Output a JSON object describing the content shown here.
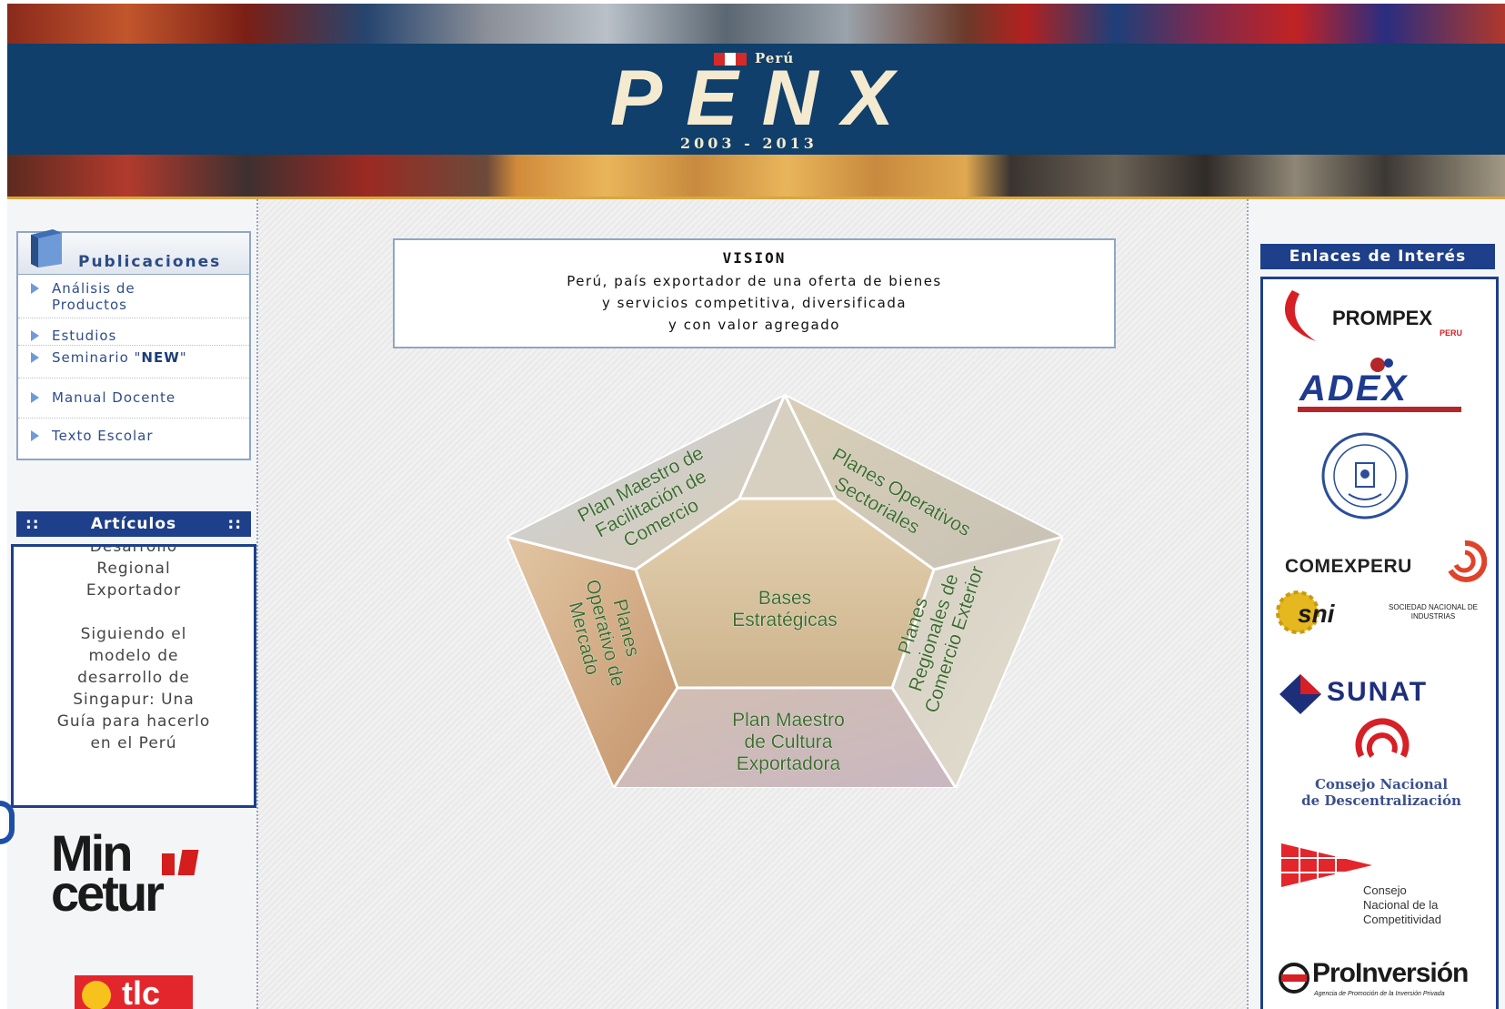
{
  "header": {
    "country": "Perú",
    "logo": "PENX",
    "years": "2003 - 2013"
  },
  "publicaciones": {
    "title": "Publicaciones",
    "items": [
      {
        "label_line1": "Análisis de",
        "label_line2": "Productos"
      },
      {
        "label": "Estudios"
      },
      {
        "label": "Seminario \"",
        "badge": "NEW",
        "suffix": "\""
      },
      {
        "label": "Manual Docente"
      },
      {
        "label": "Texto Escolar"
      }
    ]
  },
  "articulos": {
    "title": "Artículos",
    "marker": "::",
    "item1": [
      "Desarrollo",
      "Regional",
      "Exportador"
    ],
    "item2": [
      "Siguiendo el",
      "modelo de",
      "desarrollo de",
      "Singapur: Una",
      "Guía para hacerlo",
      "en el Perú"
    ]
  },
  "sponsors": {
    "mincetur_line1": "Min",
    "mincetur_line2": "cetur",
    "tlc": "tlc"
  },
  "vision": {
    "title": "VISION",
    "lines": [
      "Perú, país exportador de una oferta de bienes",
      "y servicios competitiva, diversificada",
      "y con valor agregado"
    ]
  },
  "diagram": {
    "center": [
      "Bases",
      "Estratégicas"
    ],
    "top_left": [
      "Plan Maestro de",
      "Facilitación de",
      "Comercio"
    ],
    "top_right": [
      "Planes Operativos",
      "Sectoriales"
    ],
    "left": [
      "Planes",
      "Operativo de",
      "Mercado"
    ],
    "right": [
      "Planes",
      "Regionales de",
      "Comercio Exterior"
    ],
    "bottom": [
      "Plan Maestro",
      "de Cultura",
      "Exportadora"
    ]
  },
  "links": {
    "title": "Enlaces de Interés",
    "prompex": "PROMPEX",
    "prompex_sub": "PERU",
    "adex": "ADEX",
    "comexperu": "COMEXPERU",
    "sni": "sni",
    "sni_sub": "SOCIEDAD NACIONAL DE INDUSTRIAS",
    "sunat": "SUNAT",
    "cnd": [
      "Consejo Nacional",
      "de Descentralización"
    ],
    "cnc": [
      "Consejo",
      "Nacional de la",
      "Competitividad"
    ],
    "proinversion": "ProInversión",
    "proinversion_sub": "Agencia de Promoción de la Inversión Privada"
  },
  "colors": {
    "header_blue": "#0f3f6a",
    "nav_blue": "#1e3f8a",
    "link_text": "#2f4d8a",
    "diagram_text": "#3d6b2e"
  }
}
